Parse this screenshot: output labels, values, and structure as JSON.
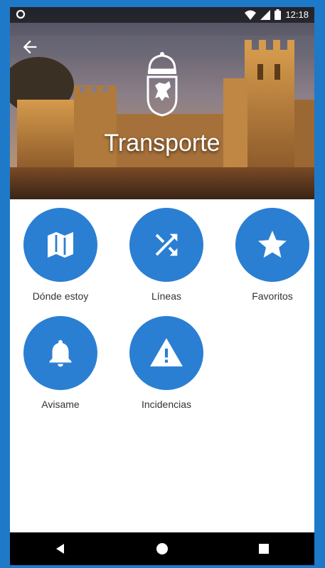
{
  "status_bar": {
    "time": "12:18"
  },
  "header": {
    "title": "Transporte"
  },
  "menu": [
    {
      "label": "Dónde estoy",
      "icon": "map-icon"
    },
    {
      "label": "Líneas",
      "icon": "shuffle-icon"
    },
    {
      "label": "Favoritos",
      "icon": "star-icon"
    },
    {
      "label": "Avisame",
      "icon": "bell-icon"
    },
    {
      "label": "Incidencias",
      "icon": "warning-icon"
    }
  ],
  "colors": {
    "accent": "#2a7fd3",
    "frame": "#1f79c9"
  }
}
